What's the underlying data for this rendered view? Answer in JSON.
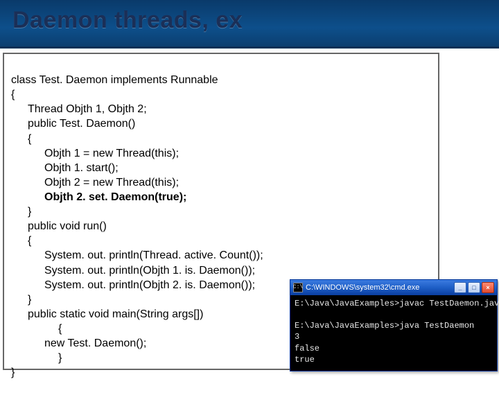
{
  "banner": {
    "title": "Daemon threads, ex"
  },
  "code": {
    "l0": "class Test. Daemon implements Runnable",
    "l1": "{",
    "l2": "Thread Objth 1, Objth 2;",
    "l3": "public Test. Daemon()",
    "l4": "{",
    "l5": "Objth 1 = new Thread(this);",
    "l6": "Objth 1. start();",
    "l7": "Objth 2 = new Thread(this);",
    "l8": "Objth 2. set. Daemon(true);",
    "l9": "}",
    "l10": "public void run()",
    "l11": "{",
    "l12": "System. out. println(Thread. active. Count());",
    "l13": "System. out. println(Objth 1. is. Daemon());",
    "l14": "System. out. println(Objth 2. is. Daemon());",
    "l15": "}",
    "l16": "public static void main(String args[])",
    "l17": "{",
    "l18": "new Test. Daemon();",
    "l19": "}",
    "l20": "}"
  },
  "terminal": {
    "title": "C:\\WINDOWS\\system32\\cmd.exe",
    "lines": {
      "t0": "E:\\Java\\JavaExamples>javac TestDaemon.java",
      "t1": "",
      "t2": "E:\\Java\\JavaExamples>java TestDaemon",
      "t3": "3",
      "t4": "false",
      "t5": "true"
    },
    "buttons": {
      "min": "_",
      "max": "□",
      "close": "×"
    },
    "icon_glyph": "C:\\"
  }
}
